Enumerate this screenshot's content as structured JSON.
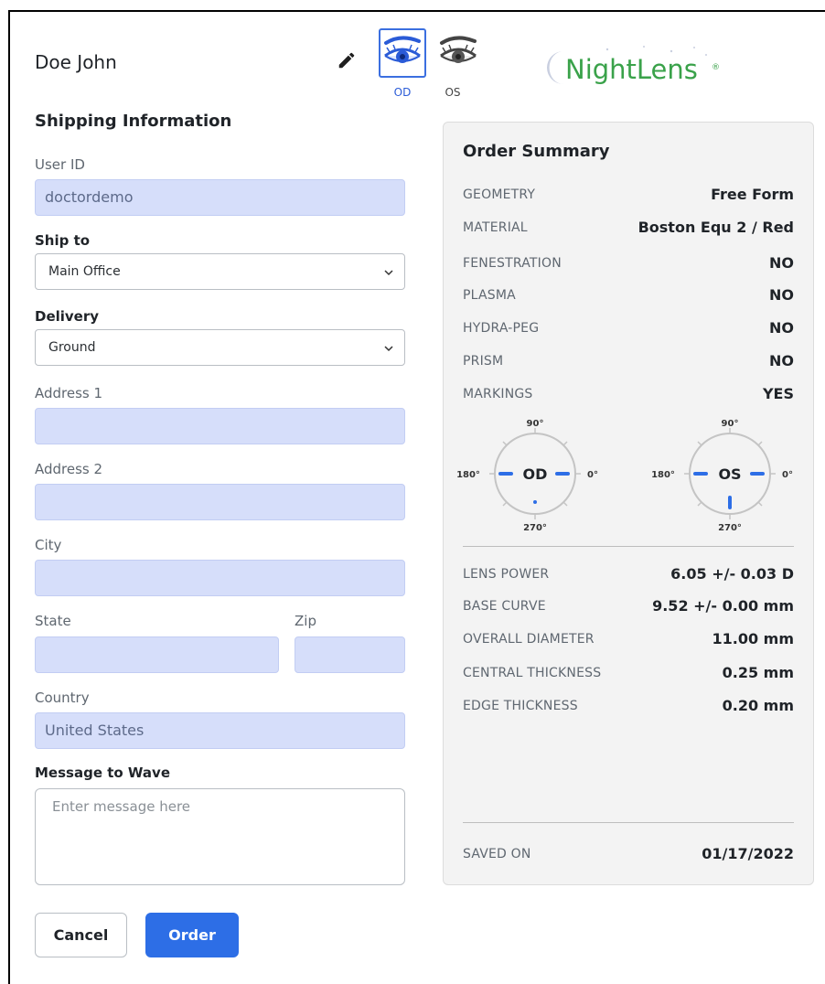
{
  "header": {
    "patient_name": "Doe John",
    "eye_tabs": [
      {
        "label": "OD",
        "selected": true
      },
      {
        "label": "OS",
        "selected": false
      }
    ],
    "brand": "NightLens",
    "brand_mark": "®",
    "accent_color": "#2d6ee6"
  },
  "shipping": {
    "title": "Shipping Information",
    "user_id_label": "User ID",
    "user_id_value": "doctordemo",
    "ship_to_label": "Ship to",
    "ship_to_value": "Main Office",
    "delivery_label": "Delivery",
    "delivery_value": "Ground",
    "address1_label": "Address 1",
    "address1_value": "",
    "address2_label": "Address 2",
    "address2_value": "",
    "city_label": "City",
    "city_value": "",
    "state_label": "State",
    "state_value": "",
    "zip_label": "Zip",
    "zip_value": "",
    "country_label": "Country",
    "country_value": "United States",
    "message_label": "Message to Wave",
    "message_placeholder": "Enter message here"
  },
  "actions": {
    "cancel_label": "Cancel",
    "order_label": "Order"
  },
  "summary": {
    "title": "Order Summary",
    "specs": [
      {
        "key": "GEOMETRY",
        "value": "Free Form"
      },
      {
        "key": "MATERIAL",
        "value": "Boston Equ 2 / Red"
      },
      {
        "key": "FENESTRATION",
        "value": "NO"
      },
      {
        "key": "PLASMA",
        "value": "NO"
      },
      {
        "key": "HYDRA-PEG",
        "value": "NO"
      },
      {
        "key": "PRISM",
        "value": "NO"
      },
      {
        "key": "MARKINGS",
        "value": "YES"
      }
    ],
    "markings": [
      {
        "eye": "OD",
        "top": "90°",
        "left": "180°",
        "right": "0°",
        "bottom": "270°",
        "bottom_mark": "dot"
      },
      {
        "eye": "OS",
        "top": "90°",
        "left": "180°",
        "right": "0°",
        "bottom": "270°",
        "bottom_mark": "bar"
      }
    ],
    "measures": [
      {
        "key": "LENS POWER",
        "value": "6.05 +/- 0.03 D"
      },
      {
        "key": "BASE CURVE",
        "value": "9.52 +/- 0.00 mm"
      },
      {
        "key": "OVERALL DIAMETER",
        "value": "11.00 mm"
      },
      {
        "key": "CENTRAL THICKNESS",
        "value": "0.25 mm"
      },
      {
        "key": "EDGE THICKNESS",
        "value": "0.20 mm"
      }
    ],
    "saved_label": "SAVED ON",
    "saved_value": "01/17/2022"
  }
}
